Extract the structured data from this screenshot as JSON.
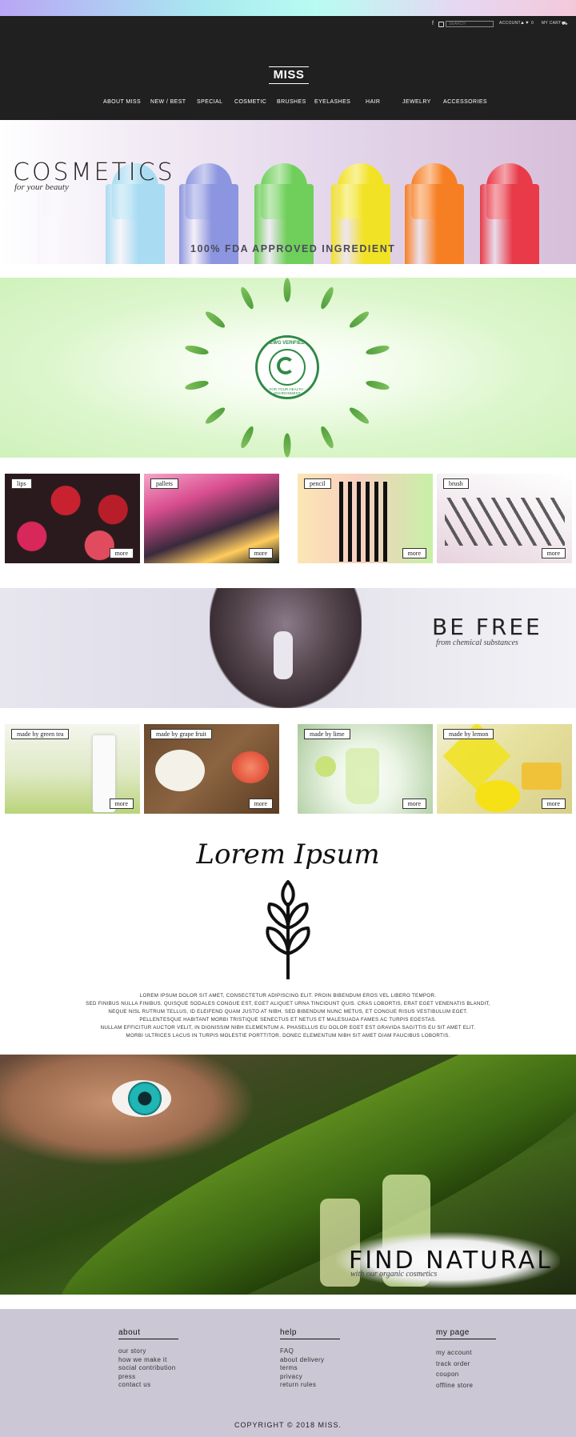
{
  "header": {
    "search_placeholder": "SEARCH",
    "account": "ACCOUNT",
    "cart_count": "0",
    "my_cart": "MY CART",
    "logo": "MISS",
    "nav": [
      "ABOUT MISS",
      "NEW / BEST",
      "SPECIAL",
      "COSMETIC",
      "BRUSHES",
      "EYELASHES",
      "HAIR",
      "JEWELRY",
      "ACCESSORIES"
    ]
  },
  "hero_cosmetics": {
    "title": "COSMETICS",
    "subtitle": "for your beauty",
    "tagline": "100% FDA APPROVED INGREDIENT",
    "lipstick_colors": [
      "#f7f4fb",
      "#a9dcf2",
      "#8c95df",
      "#6fcf5a",
      "#f2e225",
      "#f77f23",
      "#e83a48"
    ]
  },
  "hero_ewg": {
    "badge_top": "EWG VERIFIED",
    "badge_bottom": "FOR YOUR HEALTH · ENVIRONMENT",
    "brand_color": "#2f8a46"
  },
  "categories": [
    {
      "label": "lips",
      "more": "more"
    },
    {
      "label": "pallets",
      "more": "more"
    },
    {
      "label": "pencil",
      "more": "more"
    },
    {
      "label": "brush",
      "more": "more"
    }
  ],
  "hero_befree": {
    "title": "BE FREE",
    "subtitle": "from chemical substances"
  },
  "ingredients": [
    {
      "label": "made by green tea",
      "more": "more"
    },
    {
      "label": "made by grape fruit",
      "more": "more"
    },
    {
      "label": "made by lime",
      "more": "more"
    },
    {
      "label": "made by lemon",
      "more": "more"
    }
  ],
  "lorem": {
    "title": "Lorem Ipsum",
    "lines": [
      "LOREM IPSUM DOLOR SIT AMET, CONSECTETUR ADIPISCING ELIT. PROIN BIBENDUM EROS VEL LIBERO TEMPOR.",
      "SED FINIBUS NULLA FINIBUS. QUISQUE SODALES CONGUE EST, EGET ALIQUET URNA TINCIDUNT QUIS. CRAS LOBORTIS, ERAT EGET VENENATIS BLANDIT,",
      "NEQUE NISL RUTRUM TELLUS, ID ELEIFEND QUAM JUSTO AT NIBH. SED BIBENDUM NUNC METUS, ET CONGUE RISUS VESTIBULUM EGET.",
      "PELLENTESQUE HABITANT MORBI TRISTIQUE SENECTUS ET NETUS ET MALESUADA FAMES AC TURPIS EGESTAS.",
      "NULLAM EFFICITUR AUCTOR VELIT, IN DIGNISSIM NIBH ELEMENTUM A. PHASELLUS EU DOLOR EGET EST GRAVIDA SAGITTIS EU SIT AMET ELIT.",
      "MORBI ULTRICES LACUS IN TURPIS MOLESTIE PORTTITOR. DONEC ELEMENTUM NIBH SIT AMET DIAM FAUCIBUS LOBORTIS."
    ]
  },
  "hero_natural": {
    "title": "FIND NATURAL",
    "subtitle": "with our organic cosmetics"
  },
  "footer": {
    "about": {
      "heading": "about",
      "links": [
        "our story",
        "how we make it",
        "social contribution",
        "press",
        "contact us"
      ]
    },
    "help": {
      "heading": "help",
      "links": [
        "FAQ",
        "about delivery",
        "terms",
        "privacy",
        "return rules"
      ]
    },
    "mypage": {
      "heading": "my page",
      "links": [
        "my account",
        "track order",
        "coupon",
        "offline store"
      ]
    },
    "copyright": "COPYRIGHT © 2018 MISS."
  }
}
